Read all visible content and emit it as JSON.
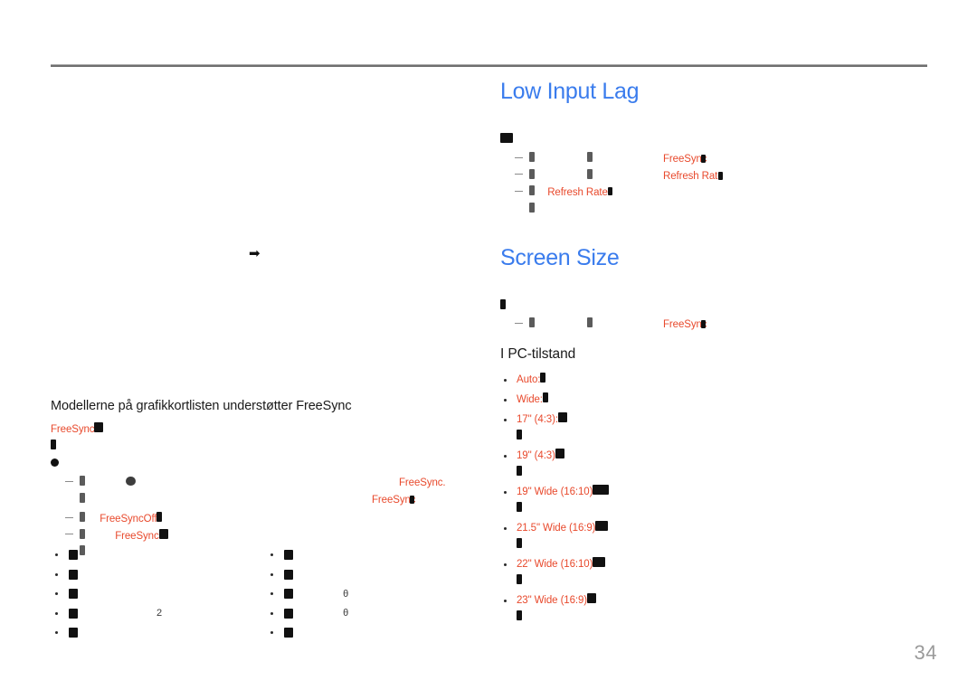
{
  "document": {
    "page_number": "34",
    "language": "da",
    "colors": {
      "heading_blue": "#3a7ced",
      "keyword_red": "#e8492c",
      "body_black": "#1a1a1a",
      "page_number_gray": "#9a9a9a",
      "rule_gray": "#6f6f6f"
    }
  },
  "left_column": {
    "arrow_marker": "➡",
    "model_heading": "Modellerne på grafikkortlisten understøtter FreeSync",
    "keyword_freesync": "FreeSync",
    "keyword_freesync_period": "FreeSync.",
    "keyword_freesyncoff": "FreeSyncOff",
    "bullet_columns": {
      "left": [
        {
          "trailing": ""
        },
        {
          "trailing": ""
        },
        {
          "trailing": ""
        },
        {
          "trailing": "2"
        },
        {
          "trailing": ""
        }
      ],
      "right": [
        {
          "trailing": ""
        },
        {
          "trailing": ""
        },
        {
          "trailing": "θ"
        },
        {
          "trailing": "θ"
        },
        {
          "trailing": ""
        }
      ]
    }
  },
  "right_column": {
    "section_low_input_lag": {
      "title": "Low Input Lag",
      "rows": [
        {
          "keyword": "FreeSync"
        },
        {
          "keyword": "Refresh Rate"
        },
        {
          "keyword": "Refresh Rate"
        }
      ]
    },
    "section_screen_size": {
      "title": "Screen Size",
      "rows": [
        {
          "keyword": "FreeSync"
        }
      ],
      "subheading": "I PC-tilstand",
      "options": [
        {
          "label": "Auto:"
        },
        {
          "label": "Wide:"
        },
        {
          "label": "17\" (4:3):"
        },
        {
          "label": "19\" (4:3)"
        },
        {
          "label": "19\" Wide (16:10)"
        },
        {
          "label": "21.5\" Wide (16:9)"
        },
        {
          "label": "22\" Wide (16:10)"
        },
        {
          "label": "23\" Wide (16:9)"
        }
      ]
    }
  }
}
